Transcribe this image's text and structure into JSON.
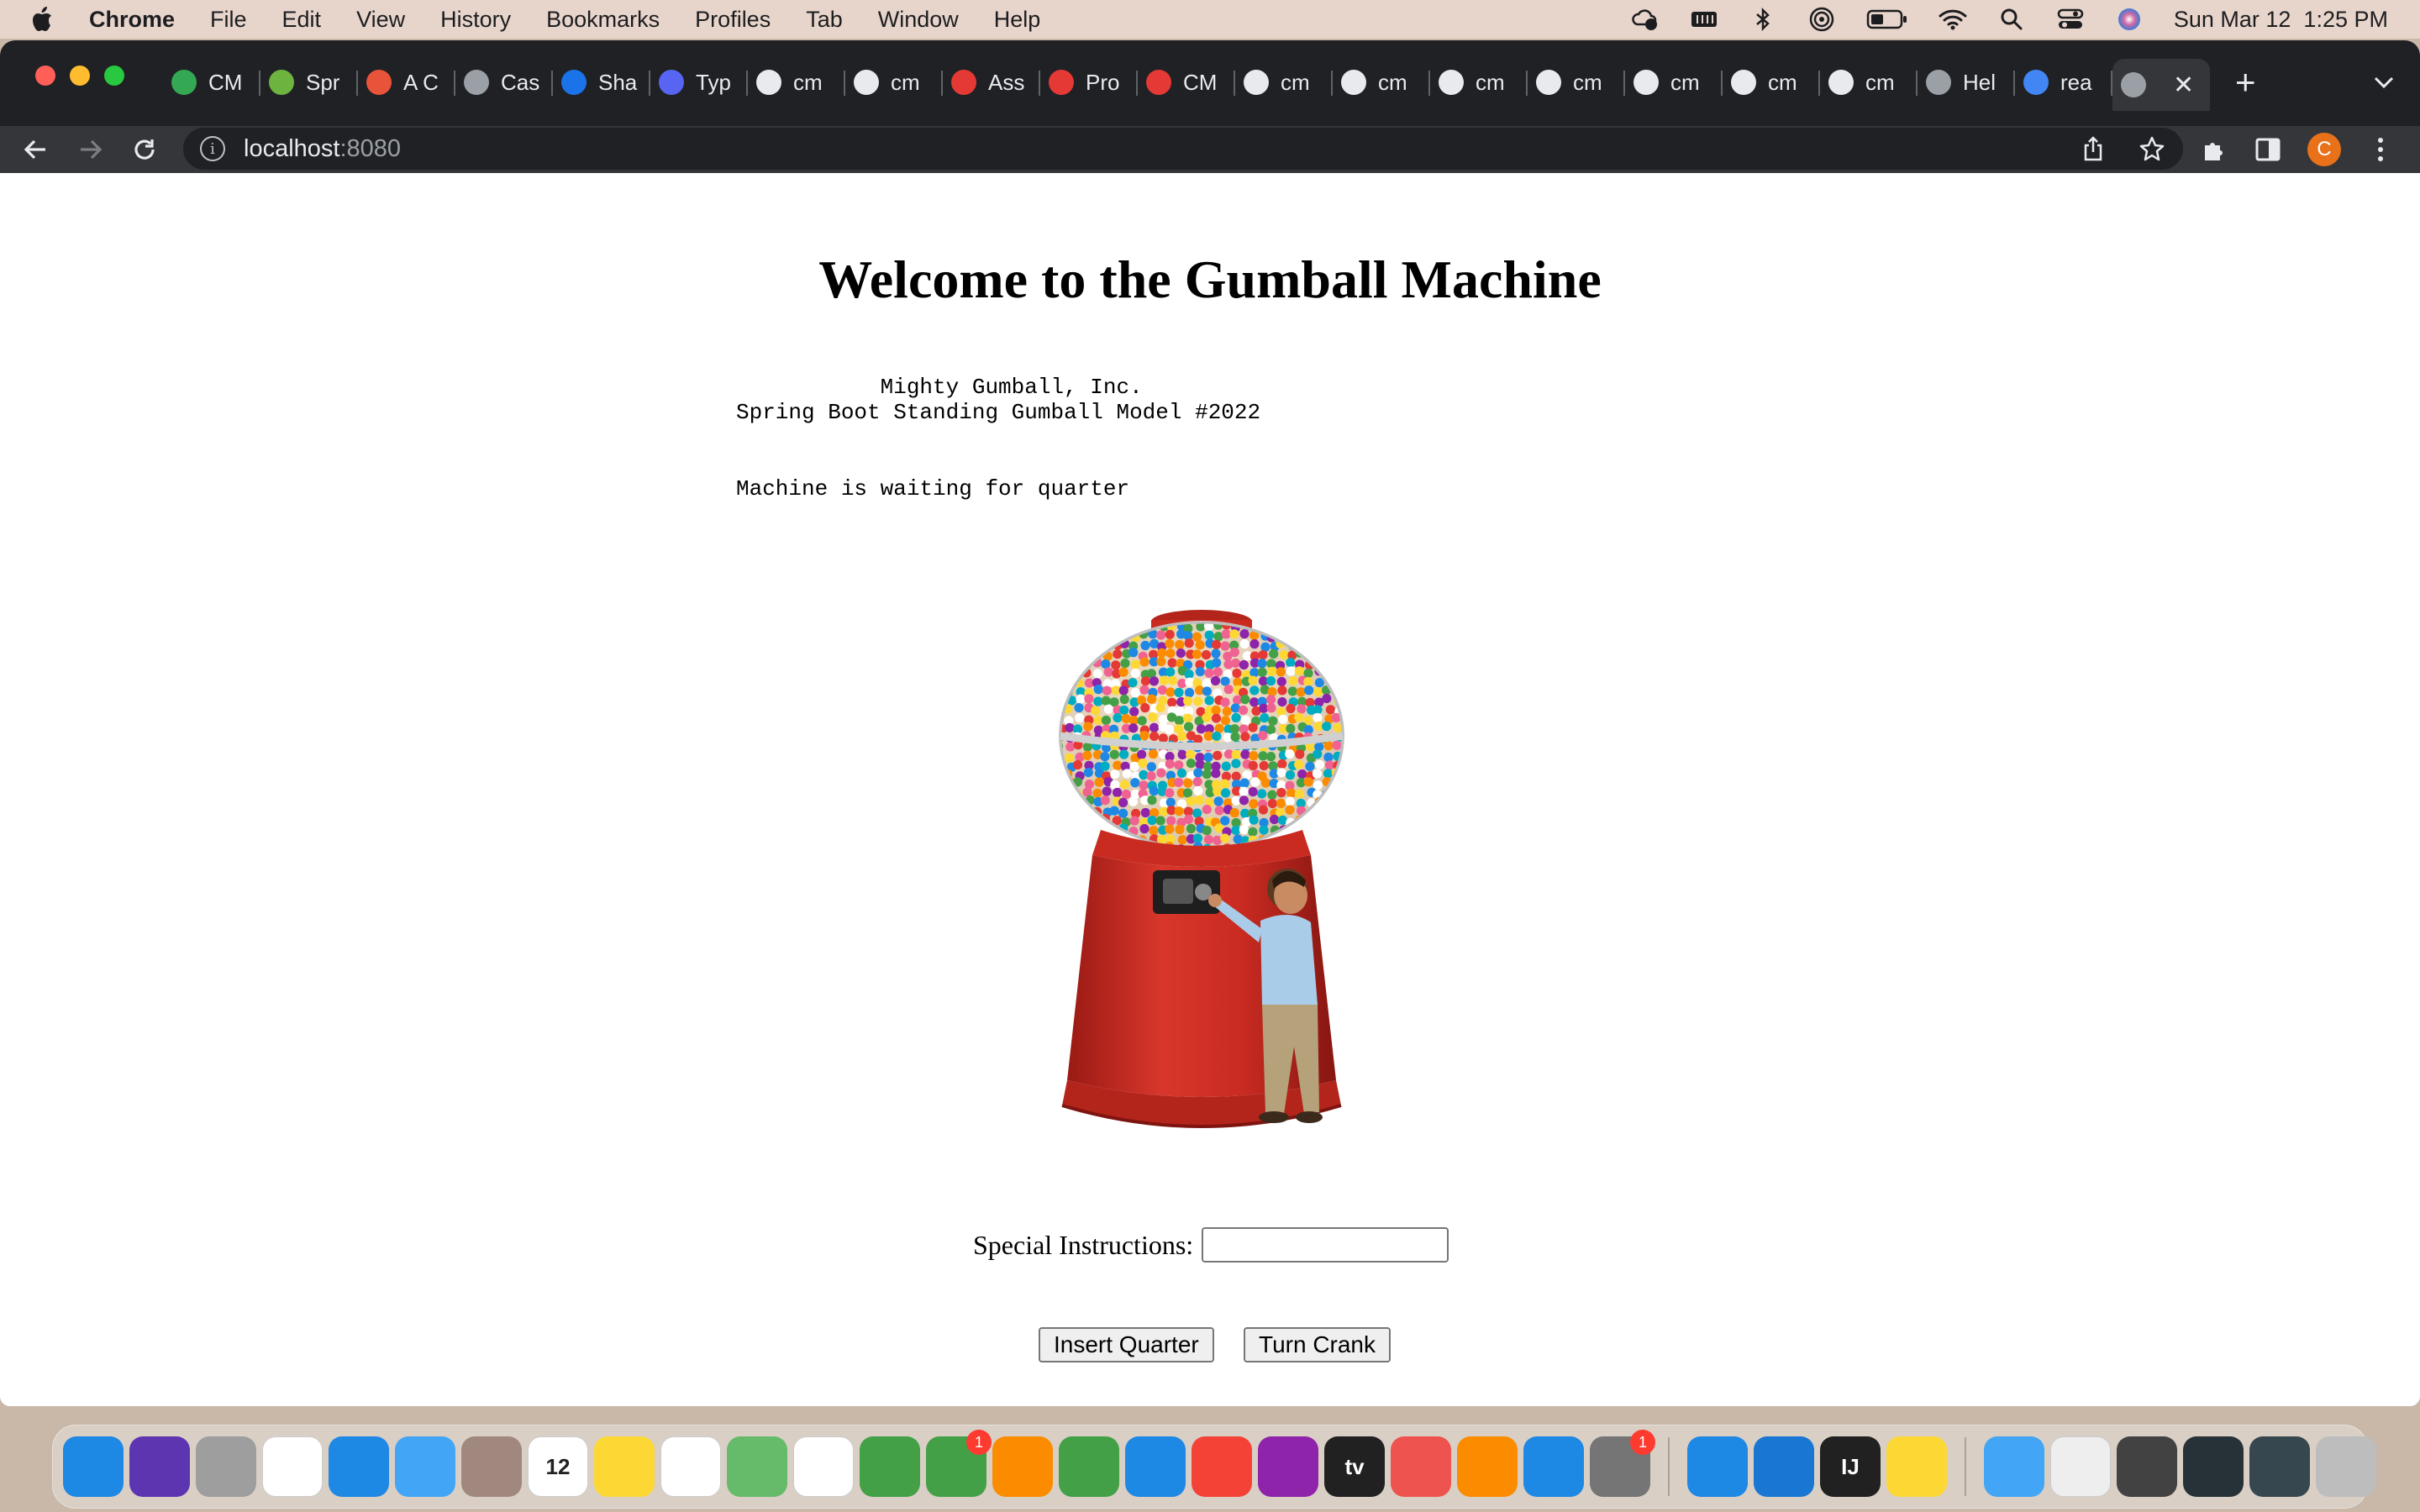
{
  "menubar": {
    "app_name": "Chrome",
    "items": [
      "File",
      "Edit",
      "View",
      "History",
      "Bookmarks",
      "Profiles",
      "Tab",
      "Window",
      "Help"
    ],
    "clock": "Sun Mar 12  1:25 PM"
  },
  "tabs": [
    {
      "title": "CM",
      "icon": "google-drive-icon",
      "color": "#34a853"
    },
    {
      "title": "Spr",
      "icon": "spring-icon",
      "color": "#6db33f"
    },
    {
      "title": "A C",
      "icon": "asterisk-icon",
      "color": "#e8543a"
    },
    {
      "title": "Cas",
      "icon": "globe-icon",
      "color": "#9aa0a6"
    },
    {
      "title": "Sha",
      "icon": "c-logo-icon",
      "color": "#1a73e8"
    },
    {
      "title": "Typ",
      "icon": "ux-icon",
      "color": "#5865f2"
    },
    {
      "title": "cm",
      "icon": "github-icon",
      "color": "#e8eaed"
    },
    {
      "title": "cm",
      "icon": "github-icon",
      "color": "#e8eaed"
    },
    {
      "title": "Ass",
      "icon": "gear-red-icon",
      "color": "#e53935"
    },
    {
      "title": "Pro",
      "icon": "gear-red-icon",
      "color": "#e53935"
    },
    {
      "title": "CM",
      "icon": "gear-red-icon",
      "color": "#e53935"
    },
    {
      "title": "cm",
      "icon": "github-icon",
      "color": "#e8eaed"
    },
    {
      "title": "cm",
      "icon": "github-icon",
      "color": "#e8eaed"
    },
    {
      "title": "cm",
      "icon": "github-icon",
      "color": "#e8eaed"
    },
    {
      "title": "cm",
      "icon": "github-icon",
      "color": "#e8eaed"
    },
    {
      "title": "cm",
      "icon": "github-icon",
      "color": "#e8eaed"
    },
    {
      "title": "cm",
      "icon": "github-icon",
      "color": "#e8eaed"
    },
    {
      "title": "cm",
      "icon": "github-icon",
      "color": "#e8eaed"
    },
    {
      "title": "Hel",
      "icon": "globe-icon",
      "color": "#9aa0a6"
    },
    {
      "title": "rea",
      "icon": "google-icon",
      "color": "#4285f4"
    }
  ],
  "address": {
    "host": "localhost",
    "port": ":8080"
  },
  "page": {
    "heading": "Welcome to the Gumball Machine",
    "company": "           Mighty Gumball, Inc.",
    "model": "Spring Boot Standing Gumball Model #2022",
    "state": "Machine is waiting for quarter",
    "special_label": "Special Instructions:",
    "special_value": "",
    "insert_button": "Insert Quarter",
    "crank_button": "Turn Crank"
  },
  "dock": [
    {
      "name": "finder-icon",
      "color": "#1e88e5"
    },
    {
      "name": "siri-icon",
      "color": "#5e35b1"
    },
    {
      "name": "launchpad-icon",
      "color": "#9e9e9e"
    },
    {
      "name": "chrome-icon",
      "color": "#ffffff"
    },
    {
      "name": "safari-icon",
      "color": "#1e88e5"
    },
    {
      "name": "mail-icon",
      "color": "#42a5f5"
    },
    {
      "name": "contacts-icon",
      "color": "#a1887f"
    },
    {
      "name": "calendar-icon",
      "color": "#ffffff",
      "text": "12"
    },
    {
      "name": "notes-icon",
      "color": "#fdd835"
    },
    {
      "name": "reminders-icon",
      "color": "#ffffff"
    },
    {
      "name": "maps-icon",
      "color": "#66bb6a"
    },
    {
      "name": "photos-icon",
      "color": "#ffffff"
    },
    {
      "name": "messages-icon",
      "color": "#43a047"
    },
    {
      "name": "facetime-icon",
      "color": "#43a047",
      "badge": "1"
    },
    {
      "name": "pages-icon",
      "color": "#fb8c00"
    },
    {
      "name": "numbers-icon",
      "color": "#43a047"
    },
    {
      "name": "keynote-icon",
      "color": "#1e88e5"
    },
    {
      "name": "music-icon",
      "color": "#f44336"
    },
    {
      "name": "podcasts-icon",
      "color": "#8e24aa"
    },
    {
      "name": "tv-icon",
      "color": "#212121",
      "text": "tv"
    },
    {
      "name": "news-icon",
      "color": "#ef5350"
    },
    {
      "name": "books-icon",
      "color": "#fb8c00"
    },
    {
      "name": "app-store-icon",
      "color": "#1e88e5"
    },
    {
      "name": "system-settings-icon",
      "color": "#757575",
      "badge": "1"
    },
    {
      "name": "docker-icon",
      "color": "#1e88e5"
    },
    {
      "name": "vscode-icon",
      "color": "#1976d2"
    },
    {
      "name": "intellij-icon",
      "color": "#212121",
      "text": "IJ"
    },
    {
      "name": "notes-app-icon",
      "color": "#fdd835"
    },
    {
      "name": "downloads-folder-icon",
      "color": "#42a5f5"
    },
    {
      "name": "window-thumb-1-icon",
      "color": "#eeeeee"
    },
    {
      "name": "window-thumb-2-icon",
      "color": "#424242"
    },
    {
      "name": "window-thumb-3-icon",
      "color": "#263238"
    },
    {
      "name": "window-thumb-4-icon",
      "color": "#37474f"
    },
    {
      "name": "trash-icon",
      "color": "#bdbdbd"
    }
  ]
}
